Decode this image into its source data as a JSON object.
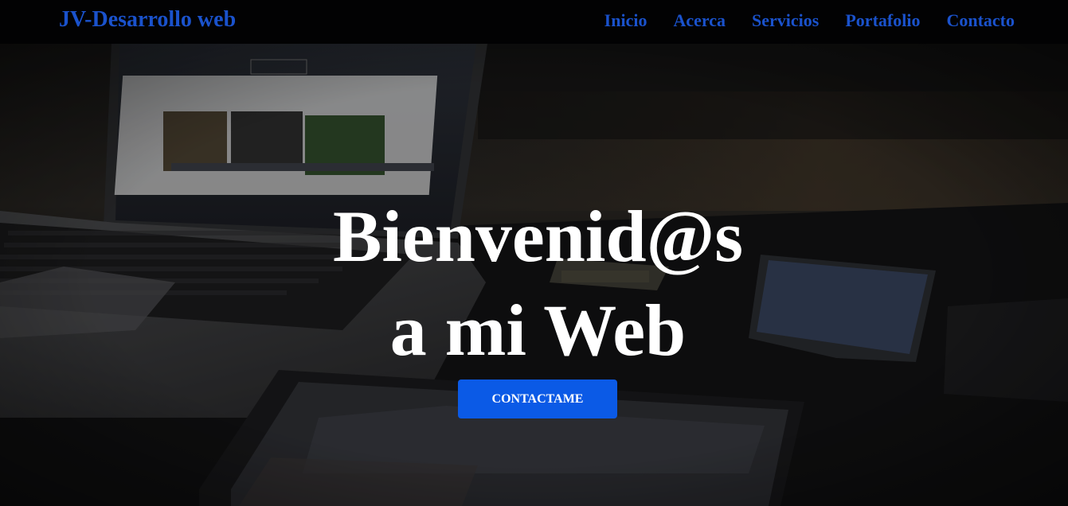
{
  "navbar": {
    "brand": "JV-Desarrollo web",
    "links": [
      {
        "label": "Inicio"
      },
      {
        "label": "Acerca"
      },
      {
        "label": "Servicios"
      },
      {
        "label": "Portafolio"
      },
      {
        "label": "Contacto"
      }
    ]
  },
  "hero": {
    "title_line1": "Bienvenid@s",
    "title_line2": "a mi Web",
    "cta_label": "CONTACTAME",
    "background": "laptop-and-devices-photo"
  },
  "colors": {
    "brand_blue": "#1a52cc",
    "cta_blue": "#0b5ae6",
    "navbar_bg": "#020203",
    "hero_text": "#ffffff"
  }
}
